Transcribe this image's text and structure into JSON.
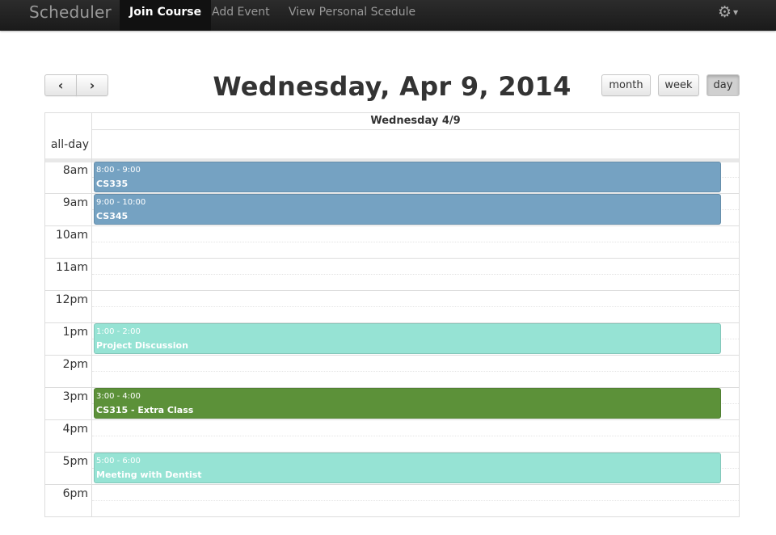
{
  "navbar": {
    "brand": "Scheduler",
    "items": [
      {
        "label": "Join Course"
      },
      {
        "label": "Add Event"
      },
      {
        "label": "View Personal Scedule"
      }
    ],
    "settings_icon": "gear-icon"
  },
  "header": {
    "prev_icon": "‹",
    "next_icon": "›",
    "title": "Wednesday, Apr 9, 2014",
    "views": [
      {
        "label": "month"
      },
      {
        "label": "week"
      },
      {
        "label": "day",
        "active": true
      }
    ]
  },
  "calendar": {
    "day_header": "Wednesday 4/9",
    "allday_label": "all-day",
    "hours": [
      "8am",
      "9am",
      "10am",
      "11am",
      "12pm",
      "1pm",
      "2pm",
      "3pm",
      "4pm",
      "5pm",
      "6pm"
    ],
    "events": [
      {
        "time": "8:00 - 9:00",
        "name": "CS335",
        "color": "#75a2c2"
      },
      {
        "time": "9:00 - 10:00",
        "name": "CS345",
        "color": "#75a2c2"
      },
      {
        "time": "1:00 - 2:00",
        "name": "Project Discussion",
        "color": "#96e3d4"
      },
      {
        "time": "3:00 - 4:00",
        "name": "CS315 - Extra Class",
        "color": "#5c9139"
      },
      {
        "time": "5:00 - 6:00",
        "name": "Meeting with Dentist",
        "color": "#96e3d4"
      }
    ]
  }
}
